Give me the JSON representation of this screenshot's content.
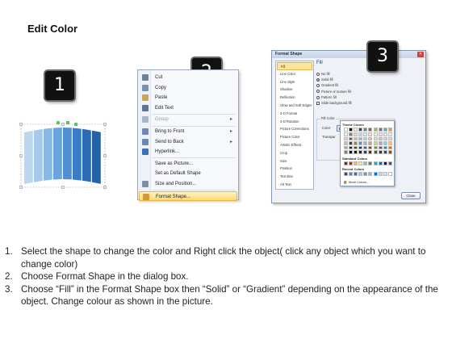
{
  "page": {
    "title": "Edit Color"
  },
  "badges": {
    "one": "1",
    "two": "2",
    "three": "3"
  },
  "context_menu": {
    "items": [
      {
        "label": "Cut",
        "icon": "scissors-icon",
        "color": "#6f7f96",
        "disabled": false,
        "arrow": false
      },
      {
        "label": "Copy",
        "icon": "copy-icon",
        "color": "#7a8fb3",
        "disabled": false,
        "arrow": false
      },
      {
        "label": "Paste",
        "icon": "paste-icon",
        "color": "#c7a55a",
        "disabled": false,
        "arrow": false
      },
      {
        "label": "Edit Text",
        "icon": "edit-text-icon",
        "color": "#5d7397",
        "disabled": false,
        "arrow": false
      },
      {
        "label": "Group",
        "icon": "group-icon",
        "color": "#a9b4c6",
        "disabled": true,
        "arrow": true
      },
      {
        "label": "Bring to Front",
        "icon": "bring-to-front-icon",
        "color": "#6e86b0",
        "disabled": false,
        "arrow": true
      },
      {
        "label": "Send to Back",
        "icon": "send-to-back-icon",
        "color": "#6e86b0",
        "disabled": false,
        "arrow": true
      },
      {
        "label": "Hyperlink...",
        "icon": "hyperlink-icon",
        "color": "#3f6fb5",
        "disabled": false,
        "arrow": false
      },
      {
        "label": "Save as Picture...",
        "icon": "",
        "color": "",
        "disabled": false,
        "arrow": false
      },
      {
        "label": "Set as Default Shape",
        "icon": "",
        "color": "",
        "disabled": false,
        "arrow": false
      },
      {
        "label": "Size and Position...",
        "icon": "size-position-icon",
        "color": "#7d8fa9",
        "disabled": false,
        "arrow": false
      },
      {
        "label": "Format Shape...",
        "icon": "format-shape-icon",
        "color": "#d49a3a",
        "disabled": false,
        "arrow": false,
        "highlighted": true
      }
    ]
  },
  "format_dialog": {
    "title": "Format Shape",
    "nav": [
      "Fill",
      "Line Color",
      "Line Style",
      "Shadow",
      "Reflection",
      "Glow and Soft Edges",
      "3-D Format",
      "3-D Rotation",
      "Picture Corrections",
      "Picture Color",
      "Artistic Effects",
      "Crop",
      "Size",
      "Position",
      "Text Box",
      "Alt Text"
    ],
    "active_nav": "Fill",
    "pane_title": "Fill",
    "fill_options": [
      {
        "label": "No fill",
        "type": "radio",
        "checked": false
      },
      {
        "label": "Solid fill",
        "type": "radio",
        "checked": true
      },
      {
        "label": "Gradient fill",
        "type": "radio",
        "checked": false
      },
      {
        "label": "Picture or texture fill",
        "type": "radio",
        "checked": false
      },
      {
        "label": "Pattern fill",
        "type": "radio",
        "checked": false
      },
      {
        "label": "Slide background fill",
        "type": "check",
        "checked": false
      }
    ],
    "fill_color_label": "Fill Color",
    "color_label": "Color:",
    "transparency_label": "Transpar",
    "close_label": "Close"
  },
  "color_picker": {
    "theme_label": "Theme Colors",
    "standard_label": "Standard Colors",
    "recent_label": "Recent Colors",
    "more_label": "More Colors...",
    "theme_top": [
      "#ffffff",
      "#000000",
      "#eeece1",
      "#1f497d",
      "#4f81bd",
      "#c0504d",
      "#9bbb59",
      "#8064a2",
      "#4bacc6",
      "#f79646"
    ],
    "theme_shades": [
      [
        "#f2f2f2",
        "#7f7f7f",
        "#ddd9c3",
        "#c6d9f0",
        "#dbe5f1",
        "#f2dcdb",
        "#ebf1dd",
        "#e5e0ec",
        "#dbeef3",
        "#fdeada"
      ],
      [
        "#d8d8d8",
        "#595959",
        "#c4bd97",
        "#8db3e2",
        "#b8cce4",
        "#e5b9b7",
        "#d7e3bc",
        "#ccc1d9",
        "#b7dde8",
        "#fbd5b5"
      ],
      [
        "#bfbfbf",
        "#3f3f3f",
        "#938953",
        "#548dd4",
        "#95b3d7",
        "#d99694",
        "#c3d69b",
        "#b2a2c7",
        "#92cddc",
        "#fac08f"
      ],
      [
        "#a5a5a5",
        "#262626",
        "#494429",
        "#17365d",
        "#366092",
        "#953734",
        "#76923c",
        "#5f497a",
        "#31859b",
        "#e36c09"
      ],
      [
        "#7f7f7f",
        "#0c0c0c",
        "#1d1b10",
        "#0f243e",
        "#244061",
        "#632423",
        "#4f6128",
        "#3f3151",
        "#205867",
        "#974806"
      ]
    ],
    "standard": [
      "#c00000",
      "#ff0000",
      "#ffc000",
      "#ffff00",
      "#92d050",
      "#00b050",
      "#00b0f0",
      "#0070c0",
      "#002060",
      "#7030a0"
    ],
    "recent": [
      "#1f497d",
      "#4f81bd",
      "#2e75b6",
      "#9dc3e6",
      "#5b9bd5",
      "#8eb4e3",
      "#0070c0",
      "#bdd7ee",
      "#dae3f3",
      "#ffffff"
    ]
  },
  "instructions": [
    {
      "num": "1.",
      "text": "Select the shape to change the color and Right click the object( click any object which you want to change color)"
    },
    {
      "num": "2.",
      "text": "Choose Format Shape in the dialog box."
    },
    {
      "num": "3.",
      "text": "Choose “Fill” in the Format Shape box then “Solid” or “Gradient” depending on the appearance of the object. Change colour as shown in the picture."
    }
  ],
  "shape": {
    "panel_colors": [
      "#bcd6ee",
      "#a6c8ea",
      "#8ab8e4",
      "#6aa4dc",
      "#4f8fd2",
      "#3b7cc6",
      "#2d6bb7",
      "#2560a8"
    ]
  }
}
